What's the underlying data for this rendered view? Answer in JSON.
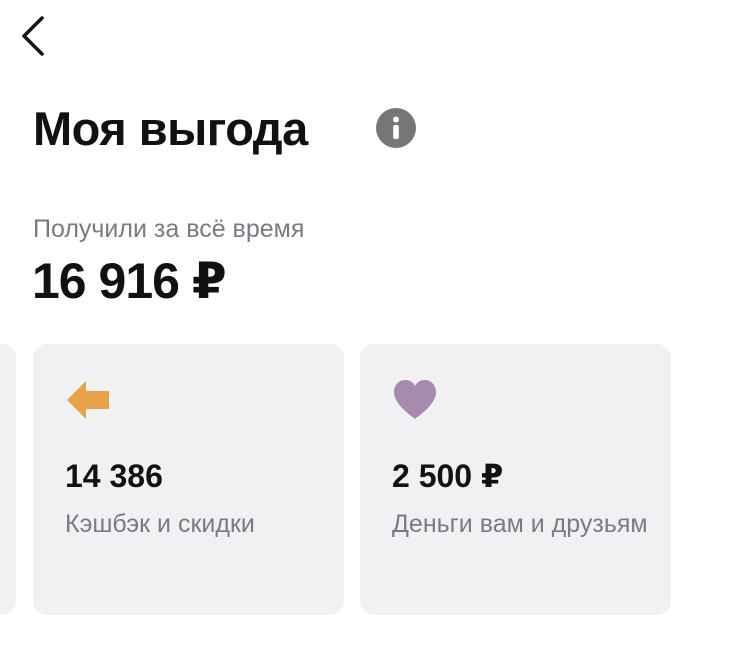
{
  "header": {
    "back_icon": "chevron-left-icon",
    "title": "Моя выгода",
    "info_icon": "info-icon"
  },
  "summary": {
    "label": "Получили за всё время",
    "amount": "16 916 ₽"
  },
  "cards": [
    {
      "icon": "arrow-left-icon",
      "icon_color": "#e8a24a",
      "value": "14 386",
      "caption": "Кэшбэк и скидки"
    },
    {
      "icon": "heart-icon",
      "icon_color": "#a78bae",
      "value": "2 500 ₽",
      "caption": "Деньги вам и друзьям"
    }
  ],
  "colors": {
    "card_background": "#f1f1f3",
    "secondary_text": "#7a7a82",
    "info_icon_background": "#767676"
  }
}
